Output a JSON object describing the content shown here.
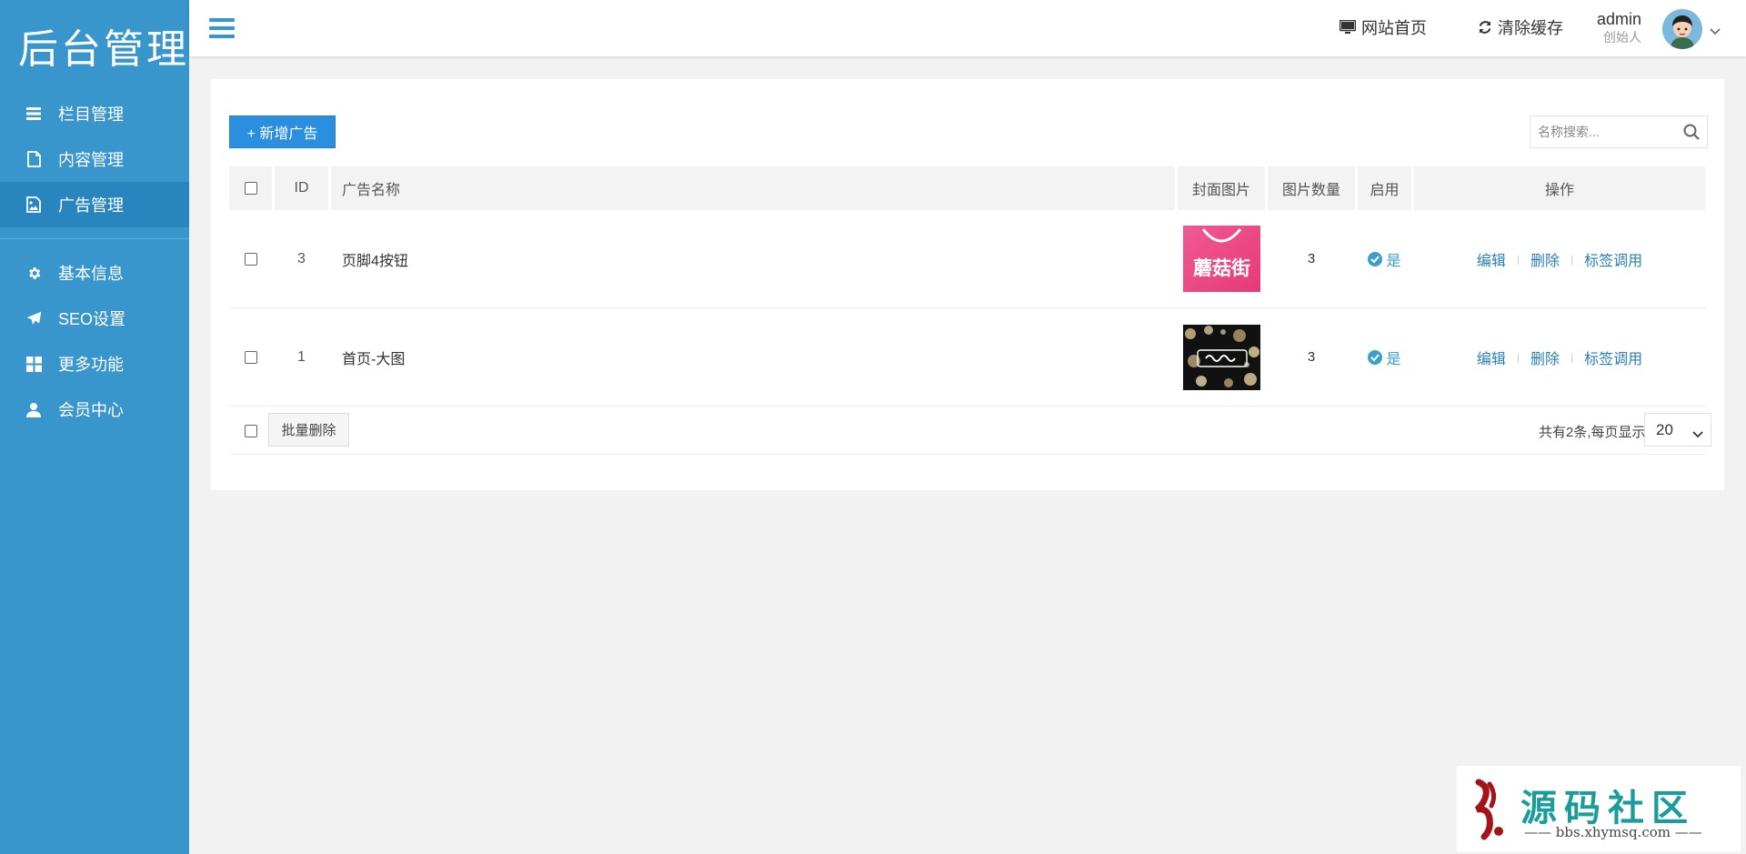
{
  "sidebar": {
    "logo": "后台管理",
    "items": [
      {
        "label": "栏目管理",
        "icon": "list-icon"
      },
      {
        "label": "内容管理",
        "icon": "file-icon"
      },
      {
        "label": "广告管理",
        "icon": "image-icon",
        "active": true
      },
      {
        "label": "基本信息",
        "icon": "gear-icon"
      },
      {
        "label": "SEO设置",
        "icon": "paper-plane-icon"
      },
      {
        "label": "更多功能",
        "icon": "grid-icon"
      },
      {
        "label": "会员中心",
        "icon": "user-icon"
      }
    ],
    "bg_color": "#3896cd",
    "active_color": "#2885bd"
  },
  "header": {
    "site_home": "网站首页",
    "clear_cache": "清除缓存",
    "user_name": "admin",
    "user_role": "创始人"
  },
  "toolbar": {
    "add_label": "+ 新增广告",
    "search_placeholder": "名称搜索..."
  },
  "table": {
    "headers": {
      "id": "ID",
      "name": "广告名称",
      "cover": "封面图片",
      "count": "图片数量",
      "enabled": "启用",
      "ops": "操作"
    },
    "rows": [
      {
        "id": "3",
        "name": "页脚4按钮",
        "cover_text": "蘑菇街",
        "count": "3",
        "enabled": "是",
        "edit": "编辑",
        "delete": "删除",
        "tag": "标签调用"
      },
      {
        "id": "1",
        "name": "首页-大图",
        "cover_text": "",
        "count": "3",
        "enabled": "是",
        "edit": "编辑",
        "delete": "删除",
        "tag": "标签调用"
      }
    ]
  },
  "footer": {
    "batch_delete": "批量删除",
    "total_text": "共有2条,每页显示",
    "page_size": "20"
  },
  "watermark": {
    "title": "源码社区",
    "url": "—— bbs.xhymsq.com ——"
  },
  "colors": {
    "accent": "#2b8fe0",
    "link": "#2a7fb5",
    "status": "#3aa0c8"
  }
}
